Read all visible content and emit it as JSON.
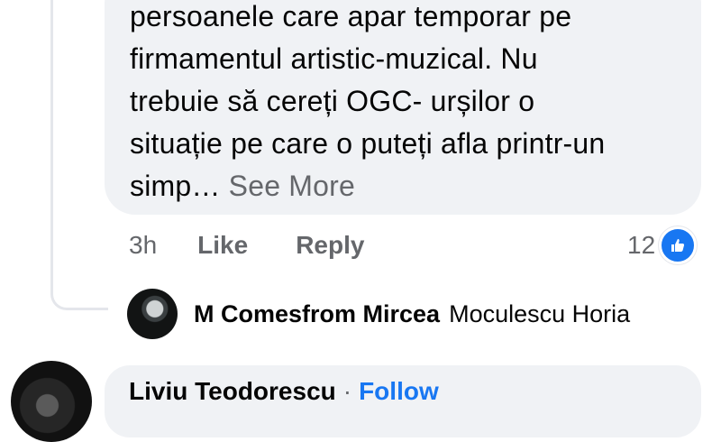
{
  "comment": {
    "lines": [
      "persoanele care apar temporar pe",
      "firmamentul artistic-muzical. Nu",
      "trebuie să cereți OGC- urșilor o",
      "situație pe care o puteți afla printr-un"
    ],
    "last_line": "simp…",
    "see_more": "See More",
    "time": "3h",
    "like_label": "Like",
    "reply_label": "Reply",
    "reaction_count": "12",
    "reaction_icon": "thumbs-up-icon"
  },
  "reply": {
    "author": "M Comesfrom Mircea",
    "tagged": "Moculescu Horia"
  },
  "next_comment": {
    "author": "Liviu Teodorescu",
    "separator": "·",
    "follow_label": "Follow"
  },
  "colors": {
    "bubble": "#f0f2f5",
    "secondary_text": "#65676b",
    "accent": "#1877f2"
  }
}
